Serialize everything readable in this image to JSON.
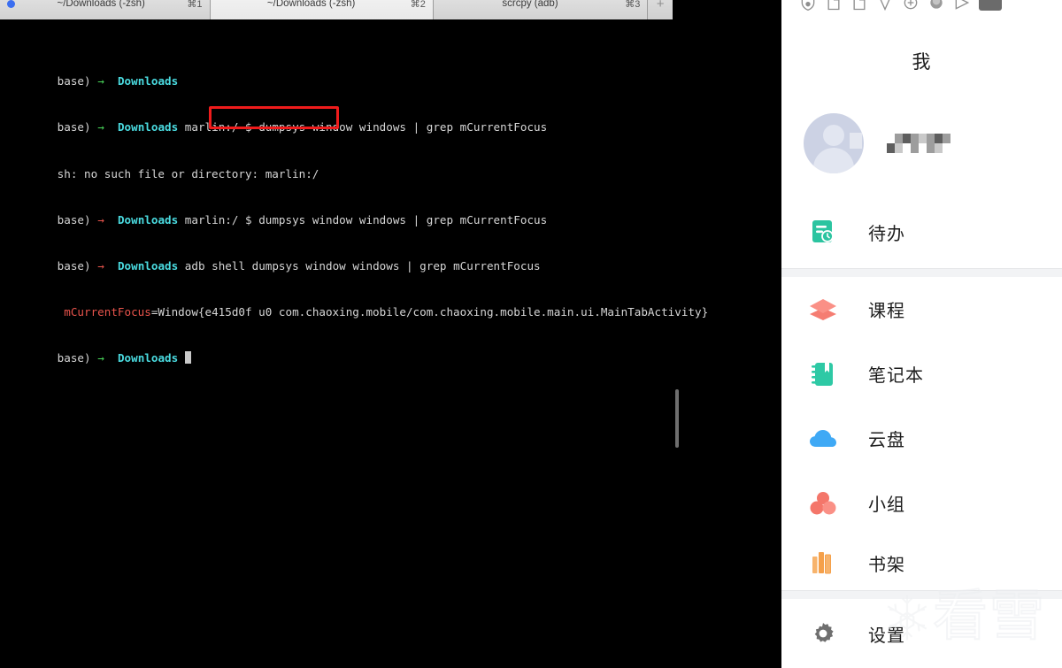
{
  "terminal": {
    "tabs": [
      {
        "title": "~/Downloads (-zsh)",
        "shortcut": "⌘1",
        "has_dot": true
      },
      {
        "title": "~/Downloads (-zsh)",
        "shortcut": "⌘2",
        "has_dot": false
      },
      {
        "title": "scrcpy (adb)",
        "shortcut": "⌘3",
        "has_dot": false
      }
    ],
    "add_tab_label": "+",
    "lines": [
      {
        "prompt": "base)",
        "arrow": "→",
        "arrow_color": "green",
        "dir": "Downloads",
        "cmd": ""
      },
      {
        "prompt": "base)",
        "arrow": "→",
        "arrow_color": "green",
        "dir": "Downloads",
        "cmd": " marlin:/ $ dumpsys window windows | grep mCurrentFocus"
      },
      {
        "type": "error",
        "text": "sh: no such file or directory: marlin:/"
      },
      {
        "prompt": "base)",
        "arrow": "→",
        "arrow_color": "red",
        "dir": "Downloads",
        "cmd": " marlin:/ $ dumpsys window windows | grep mCurrentFocus"
      },
      {
        "prompt": "base)",
        "arrow": "→",
        "arrow_color": "red",
        "dir": "Downloads",
        "cmd": " adb shell dumpsys window windows | grep mCurrentFocus"
      },
      {
        "type": "focus",
        "key": "mCurrentFocus",
        "value": "=Window{e415d0f u0 com.chaoxing.mobile/com.chaoxing.mobile.main.ui.MainTabActivity}"
      },
      {
        "prompt": "base)",
        "arrow": "→",
        "arrow_color": "green",
        "dir": "Downloads",
        "cmd": "",
        "cursor": true
      }
    ],
    "annotation": {
      "highlighted_text": "com.chaoxing.mobile/",
      "color": "#ef1b1b"
    }
  },
  "android": {
    "status_icons": [
      "shield-info-icon",
      "document-p-icon",
      "document-p-alt-icon",
      "shield-check-icon",
      "add-circle-icon",
      "circle-filled-icon",
      "send-icon",
      "battery-block-icon"
    ],
    "appbar": {
      "title": "我"
    },
    "profile": {
      "username_masked": "■■■■"
    },
    "menu": [
      {
        "label": "待办",
        "icon": "todo-icon",
        "color": "#2bc4a0"
      },
      {
        "label": "课程",
        "icon": "course-cap-icon",
        "color": "#f4766a"
      },
      {
        "label": "笔记本",
        "icon": "notebook-icon",
        "color": "#2ec9a5"
      },
      {
        "label": "云盘",
        "icon": "cloud-icon",
        "color": "#3fa9f5"
      },
      {
        "label": "小组",
        "icon": "group-icon",
        "color": "#f4766a"
      },
      {
        "label": "书架",
        "icon": "bookshelf-icon",
        "color": "#f5a04a"
      },
      {
        "label": "设置",
        "icon": "gear-icon",
        "color": "#6f6f6f"
      }
    ],
    "watermark": {
      "text": "看雪"
    }
  }
}
